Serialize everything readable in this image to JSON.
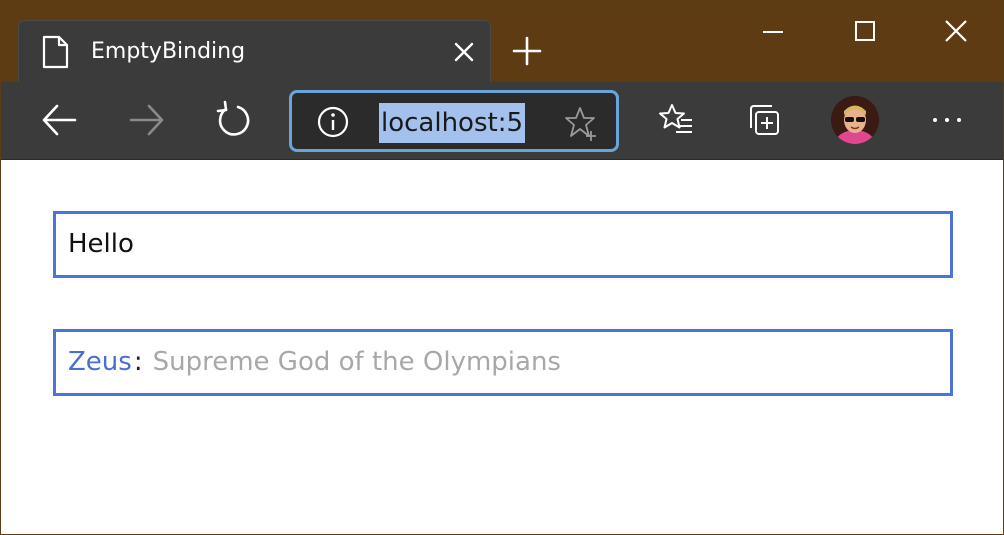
{
  "browser": {
    "tab": {
      "title": "EmptyBinding",
      "icon": "page-icon"
    },
    "address_bar": {
      "url": "localhost:5"
    },
    "colors": {
      "titlebar": "#5f3b14",
      "toolbar": "#3b3b3b",
      "address_border": "#6aa4d8",
      "url_selection": "#a3c1ec"
    }
  },
  "content": {
    "input1": {
      "value": "Hello"
    },
    "input2": {
      "name": "Zeus",
      "separator": ":",
      "description": "Supreme God of the Olympians"
    },
    "colors": {
      "input_border": "#4a74d6",
      "name_color": "#4a6fd0",
      "description_color": "#a8a8a8"
    }
  }
}
